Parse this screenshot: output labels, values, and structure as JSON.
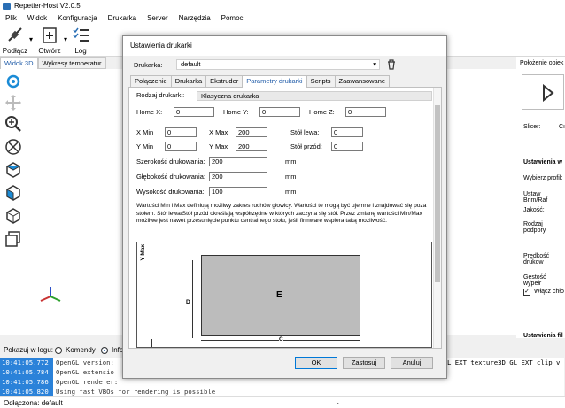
{
  "app": {
    "title": "Repetier-Host V2.0.5"
  },
  "menu": [
    "Plik",
    "Widok",
    "Konfiguracja",
    "Drukarka",
    "Server",
    "Narzędzia",
    "Pomoc"
  ],
  "toolbar": {
    "connect": "Podłącz",
    "open": "Otwórz",
    "log": "Log"
  },
  "left_tabs": [
    "Widok 3D",
    "Wykresy temperatur"
  ],
  "right_panel": {
    "header": "Położenie obiek",
    "slicer": "Slicer:",
    "slicer_val": "Cı",
    "settings": "Ustawienia w",
    "profile": "Wybierz profil:",
    "brim": "Ustaw Brim/Raf",
    "quality": "Jakość:",
    "support": "Rodzaj podpory",
    "speed": "Prędkość drukow",
    "density": "Gęstość wypełr",
    "cooling": "Włącz chło",
    "filament": "Ustawienia fil"
  },
  "log_bar": {
    "label": "Pokazuj w logu:",
    "opt1": "Komendy",
    "opt2": "Infor"
  },
  "log": [
    {
      "time": "10:41:05.772",
      "msg": "OpenGL version:",
      "tail": "L_EXT_texture3D GL_EXT_clip_v"
    },
    {
      "time": "10:41:05.784",
      "msg": "OpenGL extensio",
      "tail": ""
    },
    {
      "time": "10:41:05.786",
      "msg": "OpenGL renderer:",
      "tail": ""
    },
    {
      "time": "10:41:05.820",
      "msg": "Using fast VBOs for rendering is possible",
      "tail": ""
    }
  ],
  "status": {
    "text": "Odłączona: default",
    "dash": "-"
  },
  "dialog": {
    "title": "Ustawienia drukarki",
    "printer_label": "Drukarka:",
    "printer_value": "default",
    "tabs": [
      "Połączenie",
      "Drukarka",
      "Ekstruder",
      "Parametry drukarki",
      "Scripts",
      "Zaawansowane"
    ],
    "active_tab": 3,
    "printer_type_label": "Rodzaj drukarki:",
    "printer_type_value": "Klasyczna drukarka",
    "home": [
      {
        "label": "Home X:",
        "value": "0"
      },
      {
        "label": "Home Y:",
        "value": "0"
      },
      {
        "label": "Home Z:",
        "value": "0"
      }
    ],
    "xmin": {
      "label": "X Min",
      "value": "0"
    },
    "xmax": {
      "label": "X Max",
      "value": "200"
    },
    "left_wall": {
      "label": "Stół lewa:",
      "value": "0"
    },
    "ymin": {
      "label": "Y Min",
      "value": "0"
    },
    "ymax": {
      "label": "Y Max",
      "value": "200"
    },
    "front_wall": {
      "label": "Stół przód:",
      "value": "0"
    },
    "width": {
      "label": "Szerokość drukowania:",
      "value": "200",
      "unit": "mm"
    },
    "depth": {
      "label": "Głębokość drukowania:",
      "value": "200",
      "unit": "mm"
    },
    "height": {
      "label": "Wysokość drukowania:",
      "value": "100",
      "unit": "mm"
    },
    "help": "Wartości Min i Max definiują możliwy zakres ruchów głowicy. Wartości te mogą być ujemne i znajdować się poza stołem. Stół lewa/Stół przód określają współrzędne w których zaczyna się stół. Przez zmianę wartości Min/Max możliwe jest nawet przesunięcie punktu centralnego stołu, jeśli firmware wspiera taką możliwość.",
    "diagram": {
      "ymax": "Y Max",
      "d": "D",
      "e": "E",
      "c": "C"
    },
    "buttons": {
      "ok": "OK",
      "cancel": "Zastosuj",
      "undo": "Anuluj"
    }
  }
}
